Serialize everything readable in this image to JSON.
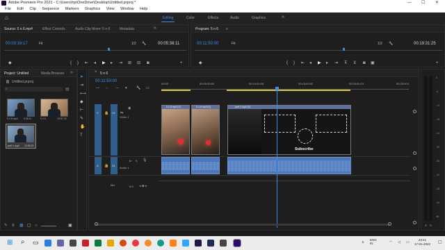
{
  "window": {
    "title": "Adobe Premiere Pro 2021 - C:\\Users\\hp\\OneDrive\\Desktop\\Untitled.prproj *",
    "minimize": "—",
    "maximize": "☐",
    "close": "✕"
  },
  "menu": [
    "File",
    "Edit",
    "Clip",
    "Sequence",
    "Markers",
    "Graphics",
    "View",
    "Window",
    "Help"
  ],
  "workspaces": {
    "home": "⌂",
    "items": [
      "Editing",
      "Color",
      "Effects",
      "Audio",
      "Graphics"
    ],
    "active": "Editing",
    "more": "»"
  },
  "source_panel": {
    "tabs": [
      "Source: 5 n 6.mp4",
      "Effect Controls",
      "Audio Clip Mixer: 5 n 6",
      "Metadata"
    ],
    "timecode": "00:03:16:17",
    "fit": "Fit",
    "ratio": "1/2",
    "duration": "00:05:38:11",
    "menu_icon": "≡",
    "more": "»"
  },
  "program_panel": {
    "tab": "Program: 5 n 6",
    "menu_icon": "≡",
    "timecode": "00:11:50:00",
    "fit": "Fit",
    "ratio": "1/2",
    "duration": "00:19:31:25"
  },
  "project_panel": {
    "tabs": [
      "Project: Untitled",
      "Media Browser"
    ],
    "more": "»",
    "file": "Untitled.prproj",
    "search_placeholder": "",
    "items": [
      {
        "name": "5 n 6.mp4",
        "duration": "5:38:11"
      },
      {
        "name": "5 n 6",
        "duration": "19:31:25"
      },
      {
        "name": "part 1.mp4",
        "duration": "13:58:20"
      }
    ]
  },
  "timeline": {
    "tab": "5 n 6",
    "timecode": "00:11:50:00",
    "ruler": [
      "00:00",
      "00:05:00:02",
      "00:10:00:05",
      "00:15:00:02",
      "00:20:00:10",
      "00:25:00:1"
    ],
    "tracks": {
      "v1": "V1",
      "v1_name": "Video 1",
      "a1": "A1",
      "a1_name": "Audio 1",
      "mix": "Mix",
      "mix_value": "0.0",
      "lock_letter": "M",
      "solo_letter": "S",
      "v_toggle": "V",
      "a_toggle": "A"
    },
    "clips": [
      {
        "label": "5 n 6.mp4 [V]"
      },
      {
        "label": "5 n 6.mp4 [V]"
      },
      {
        "label": "part 1.mp4 [V]"
      }
    ],
    "subscribe_text": "Subscribe",
    "vol_value": "0.0"
  },
  "meters": {
    "labels": [
      "0",
      "-6",
      "-12",
      "-18",
      "-24",
      "-30",
      "-36",
      "-42",
      "-48",
      "-54",
      "dB"
    ],
    "channels": [
      "S",
      "S"
    ]
  },
  "taskbar": {
    "lang": "ENG",
    "region": "IN",
    "time": "23:41",
    "date": "17-01-2022"
  },
  "colors": {
    "accent": "#3d8de8",
    "track_blue": "#2f5f8a",
    "audio_clip": "#4d77b6",
    "playhead": "#3d8de8",
    "in_out_bar": "#d6c44a"
  }
}
